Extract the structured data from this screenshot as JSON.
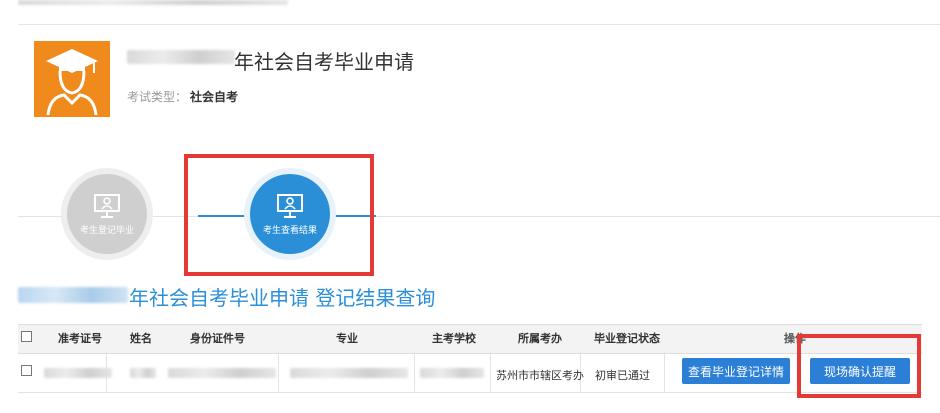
{
  "header": {
    "title": "年社会自考毕业申请",
    "exam_type_label": "考试类型：",
    "exam_type_value": "社会自考"
  },
  "steps": [
    {
      "label": "考生登记毕业",
      "active": false
    },
    {
      "label": "考生查看结果",
      "active": true
    }
  ],
  "section": {
    "title": "年社会自考毕业申请 登记结果查询"
  },
  "table": {
    "headers": [
      "准考证号",
      "姓名",
      "身份证件号",
      "专业",
      "主考学校",
      "所属考办",
      "毕业登记状态",
      "操作"
    ],
    "rows": [
      {
        "exam_office": "苏州市市辖区考办",
        "status": "初审已通过",
        "actions": [
          "查看毕业登记详情",
          "现场确认提醒"
        ]
      }
    ]
  },
  "colors": {
    "accent": "#2b8fd8",
    "button": "#2b7fd6",
    "avatar": "#f18a1c",
    "highlight": "#e53935"
  }
}
